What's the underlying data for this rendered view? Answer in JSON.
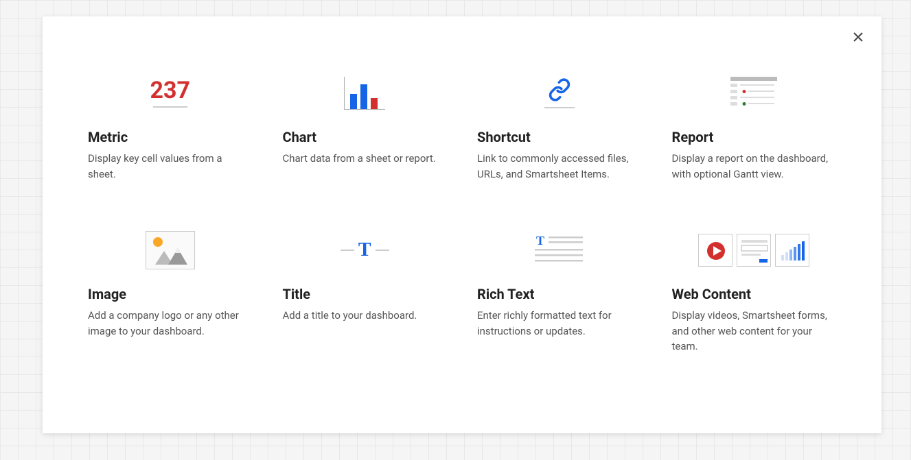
{
  "metric_number": "237",
  "widgets": [
    {
      "key": "metric",
      "title": "Metric",
      "description": "Display key cell values from a sheet."
    },
    {
      "key": "chart",
      "title": "Chart",
      "description": "Chart data from a sheet or report."
    },
    {
      "key": "shortcut",
      "title": "Shortcut",
      "description": "Link to commonly accessed files, URLs, and Smartsheet Items."
    },
    {
      "key": "report",
      "title": "Report",
      "description": "Display a report on the dashboard, with optional Gantt view."
    },
    {
      "key": "image",
      "title": "Image",
      "description": "Add a company logo or any other image to your dashboard."
    },
    {
      "key": "title",
      "title": "Title",
      "description": "Add a title to your dashboard."
    },
    {
      "key": "richtext",
      "title": "Rich Text",
      "description": "Enter richly formatted text for instructions or updates."
    },
    {
      "key": "webcontent",
      "title": "Web Content",
      "description": "Display videos, Smartsheet forms, and other web content for your team."
    }
  ]
}
